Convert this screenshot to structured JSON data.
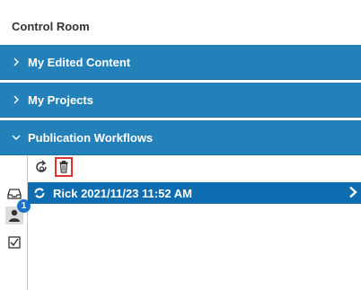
{
  "header": {
    "title": "Control Room"
  },
  "sections": [
    {
      "label": "My Edited Content",
      "expanded": false
    },
    {
      "label": "My Projects",
      "expanded": false
    },
    {
      "label": "Publication Workflows",
      "expanded": true
    }
  ],
  "workflows": {
    "notification_count": "1",
    "items": [
      {
        "label": "Rick 2021/11/23 11:52 AM"
      }
    ]
  },
  "colors": {
    "section_bg": "#2380b8",
    "row_selected_bg": "#0e6db0",
    "highlight_border": "#e0302f"
  },
  "icons": [
    "chevron-right-icon",
    "chevron-down-icon",
    "refresh-icon",
    "trash-icon",
    "inbox-icon",
    "user-icon",
    "checkbox-icon",
    "workflow-icon"
  ]
}
